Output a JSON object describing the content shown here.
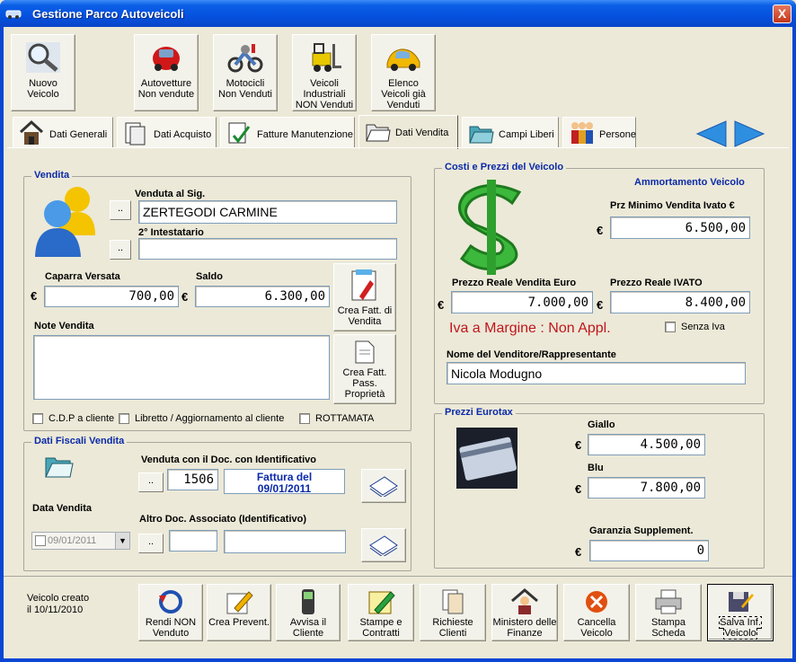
{
  "window": {
    "title": "Gestione Parco Autoveicoli",
    "close_glyph": "X"
  },
  "toolbar": [
    {
      "label": "Nuovo Veicolo",
      "icon": "magnifier-icon"
    },
    {
      "label": "Autovetture Non vendute",
      "icon": "red-car-icon"
    },
    {
      "label": "Motocicli Non Venduti",
      "icon": "motorcycle-icon"
    },
    {
      "label": "Veicoli Industriali NON Venduti",
      "icon": "forklift-icon"
    },
    {
      "label": "Elenco Veicoli già Venduti",
      "icon": "yellow-car-icon"
    }
  ],
  "tabs": [
    {
      "label": "Dati Generali"
    },
    {
      "label": "Dati Acquisto"
    },
    {
      "label": "Fatture Manutenzione"
    },
    {
      "label": "Dati Vendita",
      "active": true
    },
    {
      "label": "Campi Liberi"
    },
    {
      "label": "Persone"
    }
  ],
  "vendita": {
    "group_title": "Vendita",
    "buyer_label": "Venduta al Sig.",
    "buyer_value": "ZERTEGODI CARMINE",
    "second_holder_label": "2° Intestatario",
    "second_holder_value": "",
    "lookup_label": "..",
    "deposit_label": "Caparra Versata",
    "deposit_value": "700,00",
    "balance_label": "Saldo",
    "balance_value": "6.300,00",
    "currency": "€",
    "create_invoice_button": "Crea Fatt. di Vendita",
    "notes_label": "Note Vendita",
    "notes_value": "",
    "create_passive_invoice_button": "Crea Fatt. Pass. Proprietà",
    "checkbox_cdp": "C.D.P a cliente",
    "checkbox_libretto": "Libretto / Aggiornamento al cliente",
    "checkbox_rottamata": "ROTTAMATA"
  },
  "fiscali": {
    "group_title": "Dati Fiscali Vendita",
    "doc_label": "Venduta con il Doc. con Identificativo",
    "doc_id": "1506",
    "doc_description_line1": "Fattura del",
    "doc_description_line2": "09/01/2011",
    "date_label": "Data Vendita",
    "date_value": "09/01/2011",
    "other_doc_label": "Altro Doc. Associato (Identificativo)",
    "other_doc_id": "",
    "other_doc_description": ""
  },
  "costi": {
    "group_title": "Costi e Prezzi del Veicolo",
    "ammortamento_label": "Ammortamento Veicolo",
    "min_price_label": "Prz Minimo Vendita Ivato €",
    "min_price_value": "6.500,00",
    "real_price_label": "Prezzo Reale Vendita Euro",
    "real_price_value": "7.000,00",
    "real_price_vat_label": "Prezzo Reale IVATO",
    "real_price_vat_value": "8.400,00",
    "iva_text": "Iva a Margine : Non Appl.",
    "senza_iva_label": "Senza Iva",
    "seller_label": "Nome del Venditore/Rappresentante",
    "seller_value": "Nicola Modugno"
  },
  "eurotax": {
    "group_title": "Prezzi Eurotax",
    "giallo_label": "Giallo",
    "giallo_value": "4.500,00",
    "blu_label": "Blu",
    "blu_value": "7.800,00",
    "garanzia_label": "Garanzia Supplement.",
    "garanzia_value": "0"
  },
  "footer": {
    "created_line1": "Veicolo creato",
    "created_line2": "il 10/11/2010",
    "buttons": [
      {
        "label": "Rendi NON Venduto",
        "icon": "undo-icon"
      },
      {
        "label": "Crea Prevent.",
        "icon": "pencil-note-icon"
      },
      {
        "label": "Avvisa il Cliente",
        "icon": "phone-icon"
      },
      {
        "label": "Stampe e Contratti",
        "icon": "pencil-edit-icon"
      },
      {
        "label": "Richieste Clienti",
        "icon": "documents-icon"
      },
      {
        "label": "Ministero delle Finanze",
        "icon": "person-house-icon"
      },
      {
        "label": "Cancella Veicolo",
        "icon": "delete-icon"
      },
      {
        "label": "Stampa Scheda",
        "icon": "printer-icon"
      },
      {
        "label": "Salva Inf. Veicolo",
        "icon": "save-icon"
      }
    ]
  }
}
